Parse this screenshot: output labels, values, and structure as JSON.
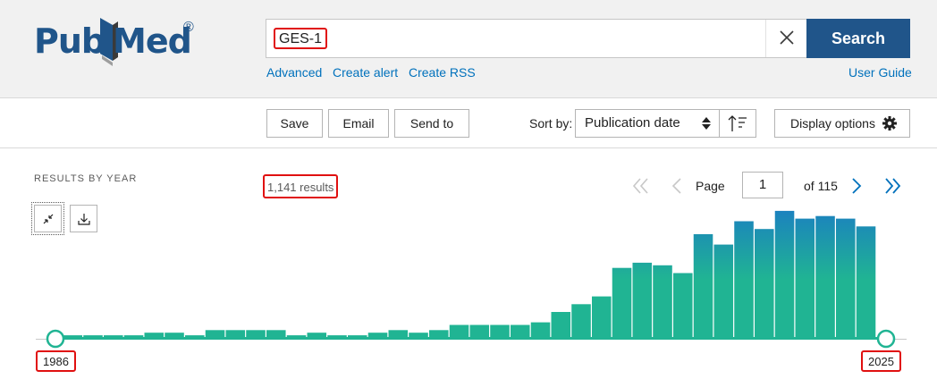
{
  "header": {
    "logo": {
      "part1": "Pub",
      "part2": "Med",
      "reg": "®"
    },
    "search": {
      "value": "GES-1",
      "button_label": "Search"
    },
    "links": {
      "advanced": "Advanced",
      "create_alert": "Create alert",
      "create_rss": "Create RSS",
      "user_guide": "User Guide"
    }
  },
  "toolbar": {
    "save_label": "Save",
    "email_label": "Email",
    "send_to_label": "Send to",
    "sort_by_label": "Sort by:",
    "sort_value": "Publication date",
    "display_options_label": "Display options"
  },
  "results": {
    "section_title": "RESULTS BY YEAR",
    "count_text": "1,141 results",
    "page_label": "Page",
    "page_value": "1",
    "page_of": "of 115",
    "year_start": "1986",
    "year_end": "2025"
  },
  "colors": {
    "brand": "#20558a",
    "link": "#0071bc",
    "bar_top": "#1b80c0",
    "bar_bottom": "#20b493",
    "highlight": "#e01010"
  },
  "chart_data": {
    "type": "bar",
    "categories": [
      "1986",
      "1987",
      "1988",
      "1989",
      "1990",
      "1991",
      "1992",
      "1993",
      "1994",
      "1995",
      "1996",
      "1997",
      "1998",
      "1999",
      "2000",
      "2001",
      "2002",
      "2003",
      "2004",
      "2005",
      "2006",
      "2007",
      "2008",
      "2009",
      "2010",
      "2011",
      "2012",
      "2013",
      "2014",
      "2015",
      "2016",
      "2017",
      "2018",
      "2019",
      "2020",
      "2021",
      "2022",
      "2023",
      "2024",
      "2025"
    ],
    "values": [
      1,
      1,
      1,
      1,
      2,
      2,
      1,
      3,
      3,
      3,
      3,
      1,
      2,
      1,
      1,
      2,
      3,
      2,
      3,
      5,
      5,
      5,
      5,
      6,
      10,
      13,
      16,
      27,
      29,
      28,
      25,
      40,
      36,
      45,
      42,
      49,
      46,
      47,
      46,
      43
    ],
    "ylim": [
      0,
      50
    ],
    "x_range": [
      "1986",
      "2025"
    ]
  }
}
